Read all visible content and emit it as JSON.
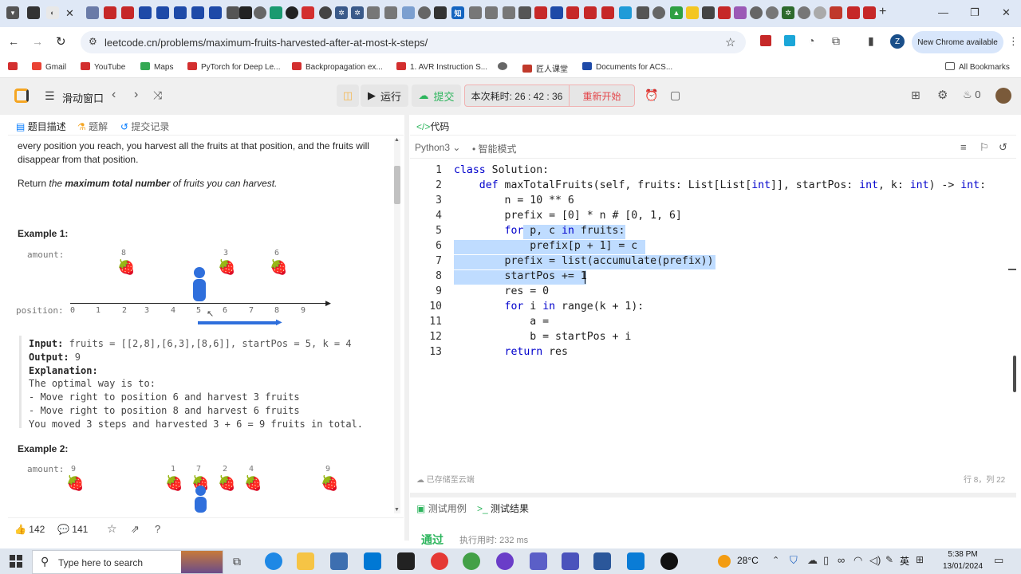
{
  "browser": {
    "url": "leetcode.cn/problems/maximum-fruits-harvested-after-at-most-k-steps/",
    "new_chrome": "New Chrome available",
    "bookmarks": [
      "Gmail",
      "YouTube",
      "Maps",
      "PyTorch for Deep Le...",
      "Backpropagation ex...",
      "1. AVR Instruction S...",
      "",
      "匠人课堂",
      "Documents for ACS...",
      "All Bookmarks"
    ],
    "profile_letter": "Z"
  },
  "lc_header": {
    "problem_list": "滑动窗口",
    "run": "运行",
    "submit": "提交",
    "timer_label": "本次耗时: 26 : 42 : 36",
    "restart": "重新开始",
    "points": "0"
  },
  "left": {
    "tabs": [
      "题目描述",
      "题解",
      "提交记录"
    ],
    "para1": "every position you reach, you harvest all the fruits at that position, and the fruits will",
    "para2": "disappear from that position.",
    "ret_pre": "Return ",
    "ret_the": "the ",
    "ret_bold": "maximum total number",
    "ret_post": " of fruits you can harvest.",
    "ex1_title": "Example 1:",
    "amount_label": "amount:",
    "position_label": "position:",
    "ex1_amounts": [
      "8",
      "3",
      "6"
    ],
    "ex1_positions": [
      "0",
      "1",
      "2",
      "3",
      "4",
      "5",
      "6",
      "7",
      "8",
      "9"
    ],
    "ex1_input_label": "Input:",
    "ex1_input": " fruits = [[2,8],[6,3],[8,6]], startPos = 5, k = 4",
    "ex1_output_label": "Output:",
    "ex1_output": " 9",
    "ex1_expl_label": "Explanation:",
    "ex1_lines": [
      "The optimal way is to:",
      "- Move right to position 6 and harvest 3 fruits",
      "- Move right to position 8 and harvest 6 fruits",
      "You moved 3 steps and harvested 3 + 6 = 9 fruits in total."
    ],
    "ex2_title": "Example 2:",
    "ex2_amounts": [
      "9",
      "1",
      "7",
      "2",
      "4",
      "9"
    ],
    "likes": "142",
    "comments": "141"
  },
  "right": {
    "title": "代码",
    "language": "Python3",
    "mode": "智能模式",
    "code_lines": [
      "class Solution:",
      "    def maxTotalFruits(self, fruits: List[List[int]], startPos: int, k: int) -> int:",
      "        n = 10 ** 6",
      "        prefix = [0] * n # [0, 1, 6]",
      "        for p, c in fruits:",
      "            prefix[p + 1] = c",
      "        prefix = list(accumulate(prefix))",
      "        startPos += 1",
      "        res = 0",
      "        for i in range(k + 1):",
      "            a = ",
      "            b = startPos + i",
      "        return res"
    ],
    "line_numbers": [
      "1",
      "2",
      "3",
      "4",
      "5",
      "6",
      "7",
      "8",
      "9",
      "10",
      "11",
      "12",
      "13"
    ],
    "saved": "已存储至云端",
    "cursor_pos": "行 8，列 22",
    "bottom_tabs": [
      "测试用例",
      "测试结果"
    ],
    "result_status": "通过",
    "result_time": "执行用时: 232 ms"
  },
  "taskbar": {
    "search_placeholder": "Type here to search",
    "weather": "28°C",
    "lang": "英",
    "time": "5:38 PM",
    "date": "13/01/2024"
  }
}
